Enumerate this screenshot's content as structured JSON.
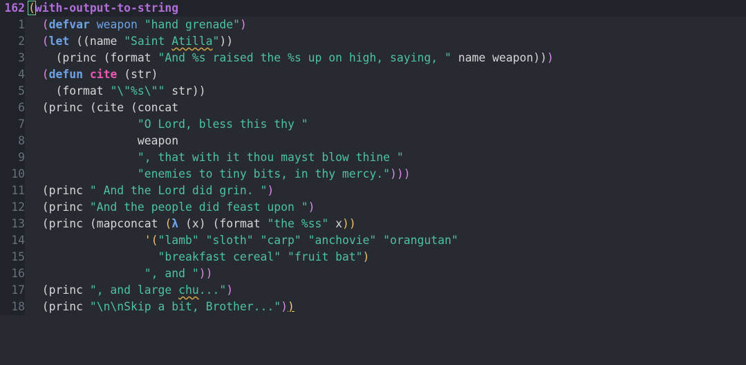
{
  "editor": {
    "current_line_number": "162",
    "lines": [
      {
        "num": "162"
      },
      {
        "num": "1"
      },
      {
        "num": "2"
      },
      {
        "num": "3"
      },
      {
        "num": "4"
      },
      {
        "num": "5"
      },
      {
        "num": "6"
      },
      {
        "num": "7"
      },
      {
        "num": "8"
      },
      {
        "num": "9"
      },
      {
        "num": "10"
      },
      {
        "num": "11"
      },
      {
        "num": "12"
      },
      {
        "num": "13"
      },
      {
        "num": "14"
      },
      {
        "num": "15"
      },
      {
        "num": "16"
      },
      {
        "num": "17"
      },
      {
        "num": "18"
      }
    ],
    "tokens": {
      "l0": {
        "a": "(",
        "b": "with-output-to-string"
      },
      "l1": {
        "indent": "  ",
        "a": "(",
        "b": "defvar",
        "c": " ",
        "d": "weapon",
        "e": " ",
        "f": "\"hand grenade\"",
        "g": ")"
      },
      "l2": {
        "indent": "  ",
        "a": "(",
        "b": "let",
        "c": " ((name ",
        "d": "\"Saint ",
        "e": "Atilla",
        "f": "\"",
        "g": "))"
      },
      "l3": {
        "indent": "    ",
        "a": "(princ ",
        "b": "(format ",
        "c": "\"And %s raised the %s up on high, saying, \"",
        "d": " name weapon",
        "e": "))",
        "f": ")"
      },
      "l4": {
        "indent": "  ",
        "a": "(",
        "b": "defun",
        "c": " ",
        "d": "cite",
        "e": " (str)"
      },
      "l5": {
        "indent": "    ",
        "a": "(format ",
        "b": "\"\\\"%s\\\"\"",
        "c": " str",
        "d": "))"
      },
      "l6": {
        "indent": "  ",
        "a": "(princ ",
        "b": "(cite ",
        "c": "(concat"
      },
      "l7": {
        "indent": "                ",
        "a": "\"O Lord, bless this thy \""
      },
      "l8": {
        "indent": "                ",
        "a": "weapon"
      },
      "l9": {
        "indent": "                ",
        "a": "\", that with it thou mayst blow thine \""
      },
      "l10": {
        "indent": "                ",
        "a": "\"enemies to tiny bits, in thy mercy.\"",
        "b": ")))"
      },
      "l11": {
        "indent": "  ",
        "a": "(princ ",
        "b": "\" And the Lord did grin. \"",
        "c": ")"
      },
      "l12": {
        "indent": "  ",
        "a": "(princ ",
        "b": "\"And the people did feast upon \"",
        "c": ")"
      },
      "l13": {
        "indent": "  ",
        "a": "(princ ",
        "b": "(mapconcat ",
        "c": "(",
        "d": "λ",
        "e": " (x) ",
        "f": "(format ",
        "g": "\"the %ss\"",
        "h": " x",
        "i": "))"
      },
      "l14": {
        "indent": "                 ",
        "a": "'(",
        "b": "\"lamb\" \"sloth\" \"carp\" \"anchovie\" \"orangutan\""
      },
      "l15": {
        "indent": "                   ",
        "a": "\"breakfast cereal\" \"fruit bat\"",
        "b": ")"
      },
      "l16": {
        "indent": "                 ",
        "a": "\", and \"",
        "b": "))"
      },
      "l17": {
        "indent": "  ",
        "a": "(princ ",
        "b": "\", and large ",
        "c": "chu",
        "d": "...\"",
        "e": ")"
      },
      "l18": {
        "indent": "  ",
        "a": "(princ ",
        "b": "\"\\n\\nSkip a bit, Brother...\"",
        "c": ")",
        "d": ")"
      }
    }
  },
  "colors": {
    "background": "#282a32",
    "gutter_background": "#20232a",
    "string": "#4ec2a0",
    "keyword": "#6fa3e8",
    "function_name": "#e85ab1",
    "current_line_number": "#b16edb"
  }
}
